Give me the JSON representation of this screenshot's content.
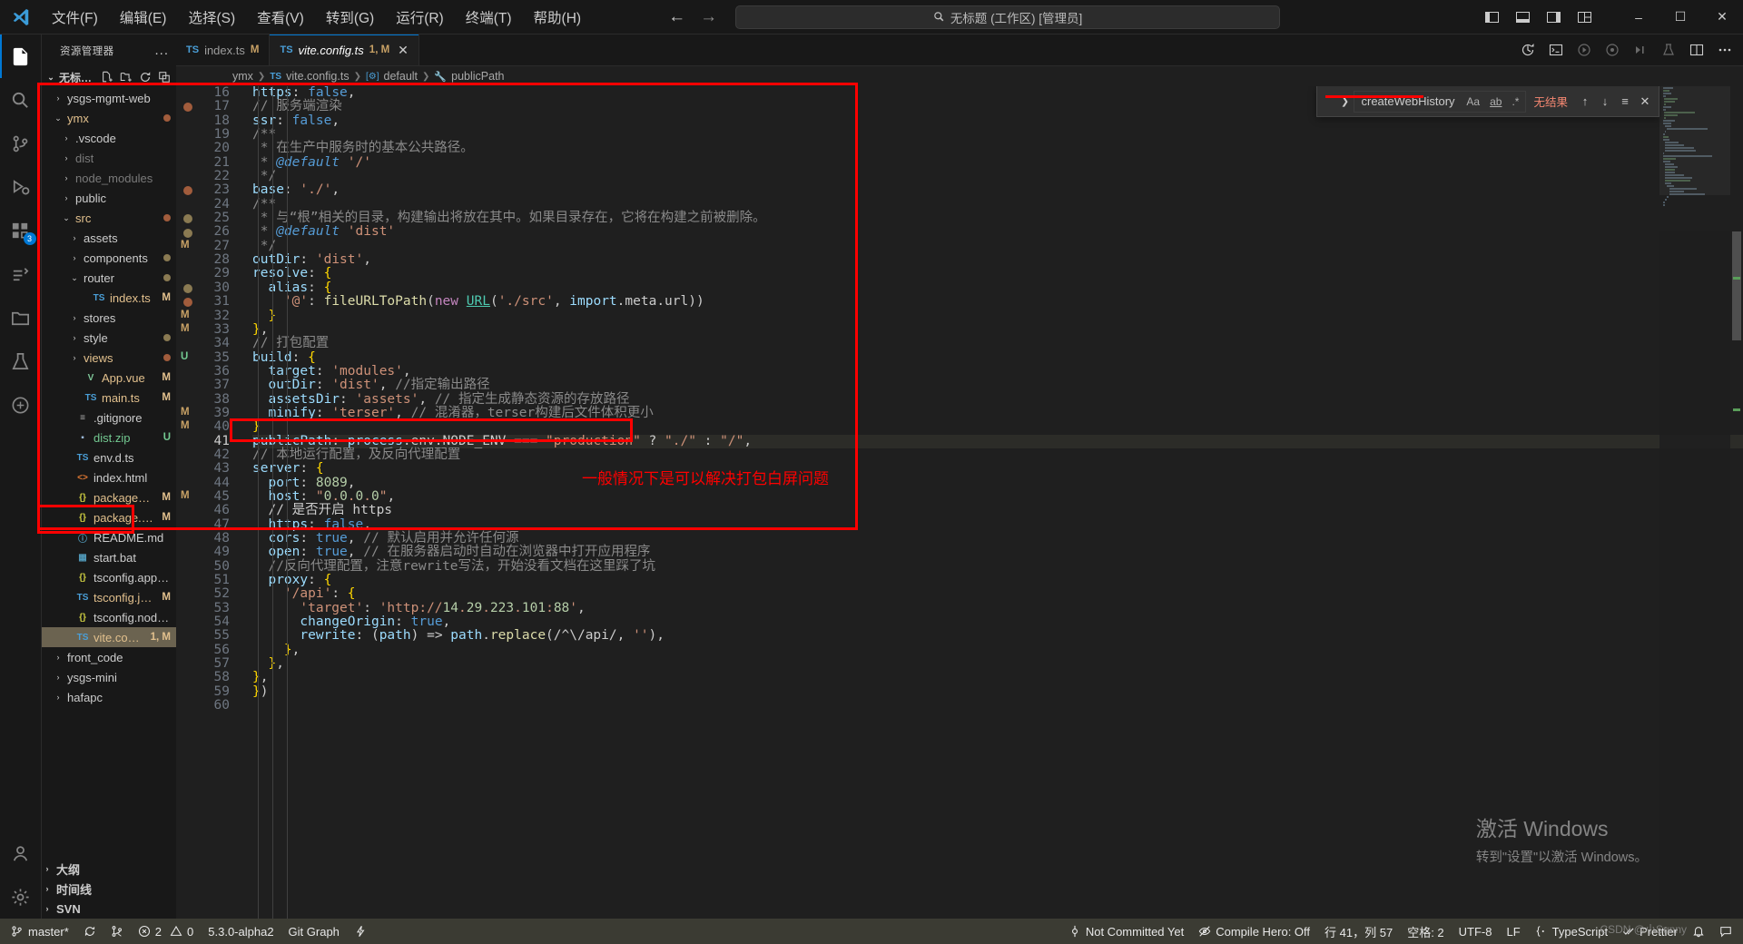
{
  "titlebar": {
    "menus": [
      "文件(F)",
      "编辑(E)",
      "选择(S)",
      "查看(V)",
      "转到(G)",
      "运行(R)",
      "终端(T)",
      "帮助(H)"
    ],
    "back_icon": "arrow-left-icon",
    "forward_icon": "arrow-right-icon",
    "quickopen_text": "无标题 (工作区) [管理员]",
    "quickopen_icon": "search-icon",
    "window_buttons": [
      "minimize",
      "maximize",
      "close"
    ]
  },
  "activitybar": {
    "items": [
      {
        "name": "explorer",
        "icon": "files-icon",
        "badge": ""
      },
      {
        "name": "search",
        "icon": "search-icon",
        "badge": ""
      },
      {
        "name": "source-control",
        "icon": "source-control-icon",
        "badge": ""
      },
      {
        "name": "run-debug",
        "icon": "run-debug-icon",
        "badge": ""
      },
      {
        "name": "extensions",
        "icon": "extensions-icon",
        "badge": "3"
      },
      {
        "name": "live-share",
        "icon": "live-share-icon",
        "badge": ""
      },
      {
        "name": "remote-explorer",
        "icon": "remote-folder-icon",
        "badge": ""
      },
      {
        "name": "test",
        "icon": "beaker-icon",
        "badge": ""
      },
      {
        "name": "docker",
        "icon": "docker-icon",
        "badge": ""
      }
    ],
    "bottom": [
      {
        "name": "accounts",
        "icon": "account-icon"
      },
      {
        "name": "settings",
        "icon": "gear-icon"
      }
    ]
  },
  "sidebar": {
    "title": "资源管理器",
    "more_label": "...",
    "workspace": "无标题 (工...",
    "workspace_actions": [
      "new-file-icon",
      "new-folder-icon",
      "refresh-icon",
      "collapse-all-icon"
    ],
    "tree": [
      {
        "indent": 1,
        "chev": "›",
        "icon": "",
        "icon_color": "",
        "name": "ysgs-mgmt-web",
        "name_color": "#cccccc",
        "status": "",
        "dot": ""
      },
      {
        "indent": 1,
        "chev": "⌄",
        "icon": "",
        "icon_color": "",
        "name": "ymx",
        "name_color": "#e2c08d",
        "status": "",
        "dot": "#a15c3c"
      },
      {
        "indent": 2,
        "chev": "›",
        "icon": "",
        "icon_color": "",
        "name": ".vscode",
        "name_color": "#cccccc",
        "status": "",
        "dot": ""
      },
      {
        "indent": 2,
        "chev": "›",
        "icon": "",
        "icon_color": "",
        "name": "dist",
        "name_color": "#7a7a7a",
        "status": "",
        "dot": ""
      },
      {
        "indent": 2,
        "chev": "›",
        "icon": "",
        "icon_color": "",
        "name": "node_modules",
        "name_color": "#7a7a7a",
        "status": "",
        "dot": ""
      },
      {
        "indent": 2,
        "chev": "›",
        "icon": "",
        "icon_color": "",
        "name": "public",
        "name_color": "#cccccc",
        "status": "",
        "dot": ""
      },
      {
        "indent": 2,
        "chev": "⌄",
        "icon": "",
        "icon_color": "",
        "name": "src",
        "name_color": "#e2c08d",
        "status": "",
        "dot": "#a15c3c"
      },
      {
        "indent": 3,
        "chev": "›",
        "icon": "",
        "icon_color": "",
        "name": "assets",
        "name_color": "#cccccc",
        "status": "",
        "dot": ""
      },
      {
        "indent": 3,
        "chev": "›",
        "icon": "",
        "icon_color": "",
        "name": "components",
        "name_color": "#cccccc",
        "status": "",
        "dot": "#8a7a52"
      },
      {
        "indent": 3,
        "chev": "⌄",
        "icon": "",
        "icon_color": "",
        "name": "router",
        "name_color": "#cccccc",
        "status": "",
        "dot": "#8a7a52"
      },
      {
        "indent": 4,
        "chev": "",
        "icon": "TS",
        "icon_color": "#4a9fd8",
        "name": "index.ts",
        "name_color": "#e2c08d",
        "status": "M",
        "dot": ""
      },
      {
        "indent": 3,
        "chev": "›",
        "icon": "",
        "icon_color": "",
        "name": "stores",
        "name_color": "#cccccc",
        "status": "",
        "dot": ""
      },
      {
        "indent": 3,
        "chev": "›",
        "icon": "",
        "icon_color": "",
        "name": "style",
        "name_color": "#cccccc",
        "status": "",
        "dot": "#8a7a52"
      },
      {
        "indent": 3,
        "chev": "›",
        "icon": "",
        "icon_color": "",
        "name": "views",
        "name_color": "#e2c08d",
        "status": "",
        "dot": "#a15c3c"
      },
      {
        "indent": 3,
        "chev": "",
        "icon": "V",
        "icon_color": "#7ec699",
        "name": "App.vue",
        "name_color": "#e2c08d",
        "status": "M",
        "dot": ""
      },
      {
        "indent": 3,
        "chev": "",
        "icon": "TS",
        "icon_color": "#4a9fd8",
        "name": "main.ts",
        "name_color": "#e2c08d",
        "status": "M",
        "dot": ""
      },
      {
        "indent": 2,
        "chev": "",
        "icon": "≡",
        "icon_color": "#b0b0b0",
        "name": ".gitignore",
        "name_color": "#cccccc",
        "status": "",
        "dot": ""
      },
      {
        "indent": 2,
        "chev": "",
        "icon": "▪",
        "icon_color": "#9cb8d8",
        "name": "dist.zip",
        "name_color": "#73c991",
        "status": "U",
        "dot": ""
      },
      {
        "indent": 2,
        "chev": "",
        "icon": "TS",
        "icon_color": "#4a9fd8",
        "name": "env.d.ts",
        "name_color": "#cccccc",
        "status": "",
        "dot": ""
      },
      {
        "indent": 2,
        "chev": "",
        "icon": "<>",
        "icon_color": "#e37933",
        "name": "index.html",
        "name_color": "#cccccc",
        "status": "",
        "dot": ""
      },
      {
        "indent": 2,
        "chev": "",
        "icon": "{}",
        "icon_color": "#cbcb41",
        "name": "package-lock.json",
        "name_color": "#e2c08d",
        "status": "M",
        "dot": ""
      },
      {
        "indent": 2,
        "chev": "",
        "icon": "{}",
        "icon_color": "#cbcb41",
        "name": "package.json",
        "name_color": "#e2c08d",
        "status": "M",
        "dot": ""
      },
      {
        "indent": 2,
        "chev": "",
        "icon": "ⓘ",
        "icon_color": "#519aba",
        "name": "README.md",
        "name_color": "#cccccc",
        "status": "",
        "dot": ""
      },
      {
        "indent": 2,
        "chev": "",
        "icon": "▦",
        "icon_color": "#519aba",
        "name": "start.bat",
        "name_color": "#cccccc",
        "status": "",
        "dot": ""
      },
      {
        "indent": 2,
        "chev": "",
        "icon": "{}",
        "icon_color": "#cbcb41",
        "name": "tsconfig.app.json",
        "name_color": "#cccccc",
        "status": "",
        "dot": ""
      },
      {
        "indent": 2,
        "chev": "",
        "icon": "TS",
        "icon_color": "#4a9fd8",
        "name": "tsconfig.json",
        "name_color": "#e2c08d",
        "status": "M",
        "dot": ""
      },
      {
        "indent": 2,
        "chev": "",
        "icon": "{}",
        "icon_color": "#cbcb41",
        "name": "tsconfig.node.json",
        "name_color": "#cccccc",
        "status": "",
        "dot": ""
      },
      {
        "indent": 2,
        "chev": "",
        "icon": "TS",
        "icon_color": "#4a9fd8",
        "name": "vite.config.ts",
        "name_color": "#e2c08d",
        "status": "1, M",
        "dot": "",
        "selected": true
      },
      {
        "indent": 1,
        "chev": "›",
        "icon": "",
        "icon_color": "",
        "name": "front_code",
        "name_color": "#cccccc",
        "status": "",
        "dot": ""
      },
      {
        "indent": 1,
        "chev": "›",
        "icon": "",
        "icon_color": "",
        "name": "ysgs-mini",
        "name_color": "#cccccc",
        "status": "",
        "dot": ""
      },
      {
        "indent": 1,
        "chev": "›",
        "icon": "",
        "icon_color": "",
        "name": "hafapc",
        "name_color": "#cccccc",
        "status": "",
        "dot": ""
      }
    ],
    "bottom_sections": [
      "大纲",
      "时间线",
      "SVN"
    ]
  },
  "tabs": [
    {
      "icon": "ts-file-icon",
      "badge": "TS",
      "name": "index.ts",
      "status": "M",
      "active": false,
      "italic": false,
      "closable": false
    },
    {
      "icon": "ts-file-icon",
      "badge": "TS",
      "name": "vite.config.ts",
      "status": "1, M",
      "active": true,
      "italic": true,
      "closable": true
    }
  ],
  "tab_actions": [
    "history-icon",
    "split-terminal-icon",
    "run-icon",
    "debug-icon",
    "more-run-icon",
    "beaker-icon",
    "split-editor-icon",
    "ellipsis-icon"
  ],
  "breadcrumb": [
    {
      "text": "ymx",
      "icon": ""
    },
    {
      "text": "vite.config.ts",
      "icon": "TS"
    },
    {
      "text": "default",
      "icon": "[@]"
    },
    {
      "text": "publicPath",
      "icon": "wrench"
    }
  ],
  "find_widget": {
    "expand_icon": "chevron-right-icon",
    "query": "createWebHistory",
    "match_case_icon": "Aa",
    "whole_word_icon": "ab",
    "regex_icon": ".*",
    "result_text": "无结果",
    "prev_icon": "↑",
    "next_icon": "↓",
    "selection_icon": "≡",
    "close_icon": "✕"
  },
  "editor": {
    "first_line": 16,
    "lines": [
      {
        "n": 16,
        "glyph": "",
        "indent": 1,
        "text": "https: false,"
      },
      {
        "n": 17,
        "glyph": "dot-red",
        "indent": 1,
        "text": "// 服务端渲染"
      },
      {
        "n": 18,
        "glyph": "",
        "indent": 1,
        "text": "ssr: false,"
      },
      {
        "n": 19,
        "glyph": "",
        "indent": 1,
        "text": "/**"
      },
      {
        "n": 20,
        "glyph": "",
        "indent": 1,
        "text": " * 在生产中服务时的基本公共路径。"
      },
      {
        "n": 21,
        "glyph": "",
        "indent": 1,
        "text": " * @default '/'"
      },
      {
        "n": 22,
        "glyph": "",
        "indent": 1,
        "text": " */"
      },
      {
        "n": 23,
        "glyph": "dot-red",
        "indent": 1,
        "text": "base: './',"
      },
      {
        "n": 24,
        "glyph": "",
        "indent": 1,
        "text": "/**"
      },
      {
        "n": 25,
        "glyph": "dot-grey",
        "indent": 1,
        "text": " * 与“根”相关的目录，构建输出将放在其中。如果目录存在，它将在构建之前被删除。"
      },
      {
        "n": 26,
        "glyph": "dot-grey",
        "indent": 1,
        "text": " * @default 'dist'"
      },
      {
        "n": 27,
        "glyph": "M",
        "indent": 1,
        "text": " */"
      },
      {
        "n": 28,
        "glyph": "",
        "indent": 1,
        "text": "outDir: 'dist',"
      },
      {
        "n": 29,
        "glyph": "",
        "indent": 1,
        "text": "resolve: {"
      },
      {
        "n": 30,
        "glyph": "dot-grey",
        "indent": 2,
        "text": "  alias: {"
      },
      {
        "n": 31,
        "glyph": "dot-red",
        "indent": 3,
        "text": "    '@': fileURLToPath(new URL('./src', import.meta.url))"
      },
      {
        "n": 32,
        "glyph": "M",
        "indent": 2,
        "text": "  }"
      },
      {
        "n": 33,
        "glyph": "M",
        "indent": 1,
        "text": "},"
      },
      {
        "n": 34,
        "glyph": "",
        "indent": 1,
        "text": "// 打包配置"
      },
      {
        "n": 35,
        "glyph": "U",
        "indent": 1,
        "text": "build: {"
      },
      {
        "n": 36,
        "glyph": "",
        "indent": 2,
        "text": "  target: 'modules',"
      },
      {
        "n": 37,
        "glyph": "",
        "indent": 2,
        "text": "  outDir: 'dist', //指定输出路径"
      },
      {
        "n": 38,
        "glyph": "",
        "indent": 2,
        "text": "  assetsDir: 'assets', // 指定生成静态资源的存放路径"
      },
      {
        "n": 39,
        "glyph": "M",
        "indent": 2,
        "text": "  minify: 'terser', // 混淆器，terser构建后文件体积更小"
      },
      {
        "n": 40,
        "glyph": "M",
        "indent": 1,
        "text": "}"
      },
      {
        "n": 41,
        "glyph": "",
        "indent": 1,
        "text": "publicPath: process.env.NODE_ENV === \"production\" ? \"./\" : \"/\",",
        "highlighted": true
      },
      {
        "n": 42,
        "glyph": "",
        "indent": 1,
        "text": "// 本地运行配置，及反向代理配置"
      },
      {
        "n": 43,
        "glyph": "",
        "indent": 1,
        "text": "server: {"
      },
      {
        "n": 44,
        "glyph": "",
        "indent": 2,
        "text": "  port: 8089,"
      },
      {
        "n": 45,
        "glyph": "M",
        "indent": 2,
        "text": "  host: \"0.0.0.0\","
      },
      {
        "n": 46,
        "glyph": "",
        "indent": 2,
        "text": "  // 是否开启 https"
      },
      {
        "n": 47,
        "glyph": "",
        "indent": 2,
        "text": "  https: false,"
      },
      {
        "n": 48,
        "glyph": "",
        "indent": 2,
        "text": "  cors: true, // 默认启用并允许任何源"
      },
      {
        "n": 49,
        "glyph": "",
        "indent": 2,
        "text": "  open: true, // 在服务器启动时自动在浏览器中打开应用程序"
      },
      {
        "n": 50,
        "glyph": "",
        "indent": 2,
        "text": "  //反向代理配置，注意rewrite写法，开始没看文档在这里踩了坑"
      },
      {
        "n": 51,
        "glyph": "",
        "indent": 2,
        "text": "  proxy: {"
      },
      {
        "n": 52,
        "glyph": "",
        "indent": 3,
        "text": "    '/api': {"
      },
      {
        "n": 53,
        "glyph": "",
        "indent": 4,
        "text": "      'target': 'http://14.29.223.101:88',"
      },
      {
        "n": 54,
        "glyph": "",
        "indent": 4,
        "text": "      changeOrigin: true,"
      },
      {
        "n": 55,
        "glyph": "",
        "indent": 4,
        "text": "      rewrite: (path) => path.replace(/^\\/api/, ''),"
      },
      {
        "n": 56,
        "glyph": "",
        "indent": 3,
        "text": "    },"
      },
      {
        "n": 57,
        "glyph": "",
        "indent": 2,
        "text": "  },"
      },
      {
        "n": 58,
        "glyph": "",
        "indent": 1,
        "text": "},"
      },
      {
        "n": 59,
        "glyph": "",
        "indent": 0,
        "text": "})"
      },
      {
        "n": 60,
        "glyph": "",
        "indent": 0,
        "text": ""
      }
    ]
  },
  "annotation": {
    "note_text": "一般情况下是可以解决打包白屏问题",
    "color": "#ff0000"
  },
  "watermark": {
    "line1": "激活 Windows",
    "line2": "转到\"设置\"以激活 Windows。",
    "csdn": "CSDN @小Sunny"
  },
  "statusbar": {
    "left": [
      {
        "icon": "source-control-icon",
        "text": "master*"
      },
      {
        "icon": "sync-icon",
        "text": ""
      },
      {
        "icon": "git-branch-icon",
        "text": ""
      },
      {
        "icon": "error-icon",
        "text": "2",
        "icon2": "warning-icon",
        "text2": "0"
      },
      {
        "icon": "",
        "text": "5.3.0-alpha2"
      },
      {
        "icon": "",
        "text": "Git Graph"
      },
      {
        "icon": "zap-icon",
        "text": ""
      }
    ],
    "right": [
      {
        "icon": "git-commit-icon",
        "text": "Not Committed Yet"
      },
      {
        "icon": "eye-closed-icon",
        "text": "Compile Hero: Off"
      },
      {
        "icon": "",
        "text": "行 41，列 57"
      },
      {
        "icon": "",
        "text": "空格: 2"
      },
      {
        "icon": "",
        "text": "UTF-8"
      },
      {
        "icon": "",
        "text": "LF"
      },
      {
        "icon": "braces-icon",
        "text": "TypeScript"
      },
      {
        "icon": "check-icon",
        "text": "Prettier"
      },
      {
        "icon": "bell-icon",
        "text": ""
      },
      {
        "icon": "feedback-icon",
        "text": ""
      }
    ]
  }
}
